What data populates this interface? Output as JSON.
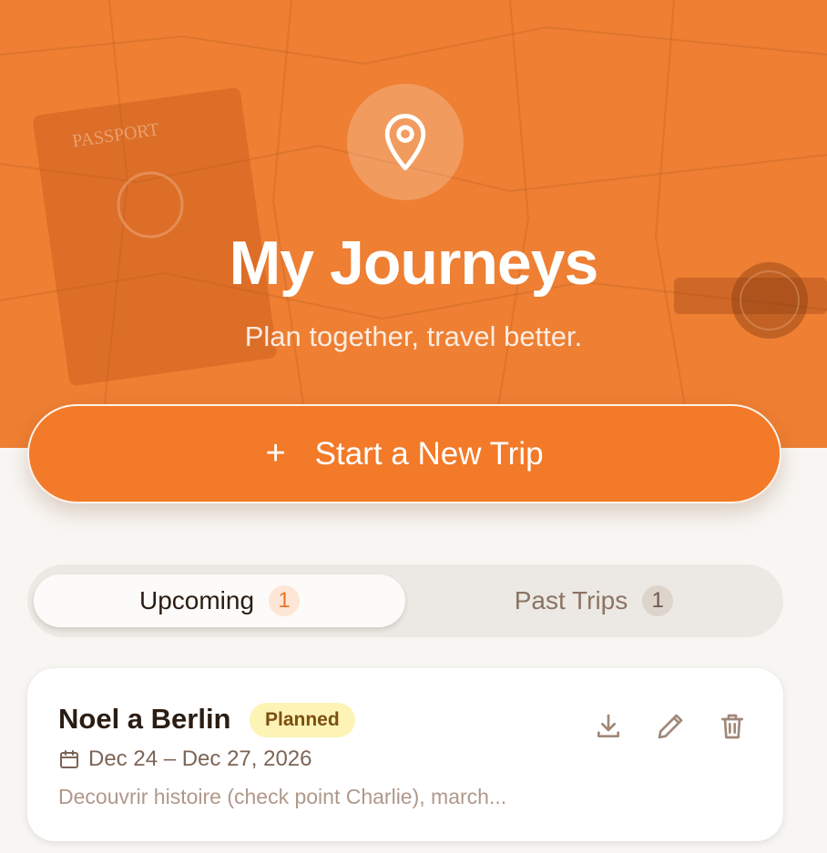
{
  "hero": {
    "title": "My Journeys",
    "subtitle": "Plan together, travel better.",
    "background_color": "#ee7f33",
    "icon": "map-pin-icon",
    "decor_text": "PASSPORT"
  },
  "cta": {
    "label": "Start a New Trip",
    "icon": "plus-icon",
    "color": "#f27a28"
  },
  "tabs": [
    {
      "label": "Upcoming",
      "count": "1",
      "active": true
    },
    {
      "label": "Past Trips",
      "count": "1",
      "active": false
    }
  ],
  "trip": {
    "name": "Noel a Berlin",
    "status": "Planned",
    "dates": "Dec 24 – Dec 27, 2026",
    "description": "Decouvrir histoire (check point Charlie), march...",
    "actions": [
      "download-icon",
      "edit-pencil-icon",
      "trash-icon"
    ]
  }
}
